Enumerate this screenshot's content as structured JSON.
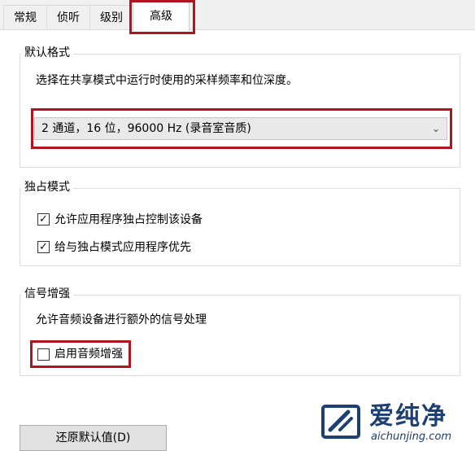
{
  "tabs": [
    {
      "label": "常规"
    },
    {
      "label": "侦听"
    },
    {
      "label": "级别"
    },
    {
      "label": "高级"
    }
  ],
  "default_format": {
    "title": "默认格式",
    "description": "选择在共享模式中运行时使用的采样频率和位深度。",
    "selected": "2 通道，16 位，96000 Hz (录音室音质)"
  },
  "exclusive_mode": {
    "title": "独占模式",
    "allow_exclusive": {
      "label": "允许应用程序独占控制该设备",
      "checked": true
    },
    "exclusive_priority": {
      "label": "给与独占模式应用程序优先",
      "checked": true
    }
  },
  "signal_enhancement": {
    "title": "信号增强",
    "description": "允许音频设备进行额外的信号处理",
    "enable_enhancement": {
      "label": "启用音频增强",
      "checked": false
    }
  },
  "restore_button": {
    "label": "还原默认值(D)"
  },
  "watermark": {
    "name": "爱纯净",
    "url": "aichunjing.com"
  },
  "colors": {
    "highlight": "#b3121f",
    "watermark": "#1d3f73"
  }
}
